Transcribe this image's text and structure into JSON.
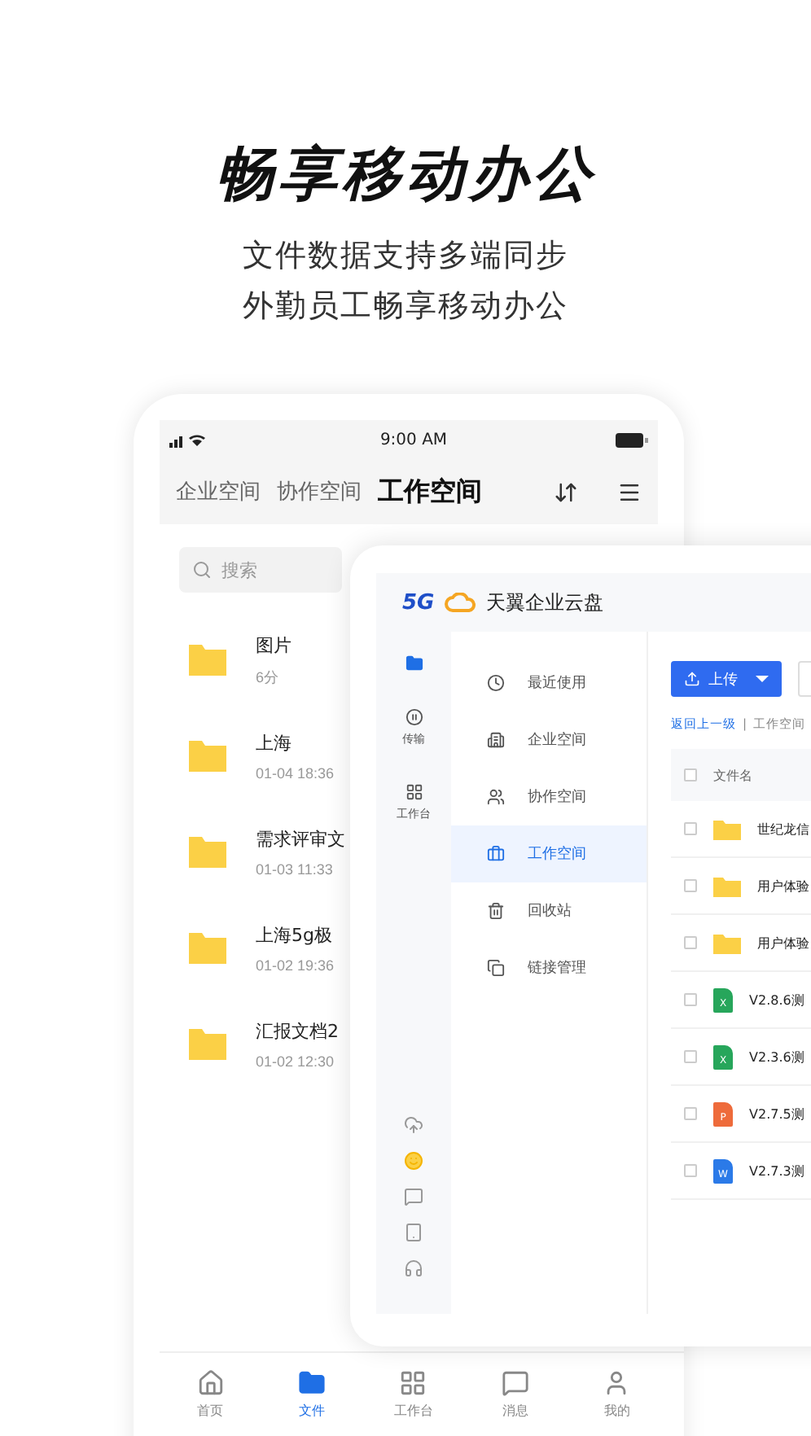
{
  "headline": "畅享移动办公",
  "subtitle_lines": [
    "文件数据支持多端同步",
    "外勤员工畅享移动办公"
  ],
  "phone": {
    "status_bar": {
      "time": "9:00 AM"
    },
    "tabs": [
      {
        "label": "企业空间",
        "selected": false
      },
      {
        "label": "协作空间",
        "selected": false
      },
      {
        "label": "工作空间",
        "selected": true
      }
    ],
    "search": {
      "placeholder": "搜索"
    },
    "files": [
      {
        "name": "图片",
        "time": "6分"
      },
      {
        "name": "上海",
        "time": "01-04 18:36"
      },
      {
        "name": "需求评审文",
        "time": "01-03 11:33"
      },
      {
        "name": "上海5g极",
        "time": "01-02 19:36"
      },
      {
        "name": "汇报文档2",
        "time": "01-02 12:30"
      }
    ],
    "bottom_nav": [
      {
        "kind": "home",
        "label": "首页",
        "selected": false
      },
      {
        "kind": "files",
        "label": "文件",
        "selected": true
      },
      {
        "kind": "apps",
        "label": "工作台",
        "selected": false
      },
      {
        "kind": "messages",
        "label": "消息",
        "selected": false
      },
      {
        "kind": "profile",
        "label": "我的",
        "selected": false
      }
    ]
  },
  "desktop": {
    "badge": "5G",
    "brand": "天翼企业云盘",
    "rail": [
      {
        "kind": "folder",
        "selected": true
      },
      {
        "kind": "transfer",
        "label": "传输",
        "selected": false
      },
      {
        "kind": "apps",
        "label": "工作台",
        "selected": false
      }
    ],
    "menu": [
      {
        "kind": "recent",
        "label": "最近使用",
        "selected": false
      },
      {
        "kind": "enterprise",
        "label": "企业空间",
        "selected": false
      },
      {
        "kind": "team",
        "label": "协作空间",
        "selected": false
      },
      {
        "kind": "workspace",
        "label": "工作空间",
        "selected": true
      },
      {
        "kind": "trash",
        "label": "回收站",
        "selected": false
      },
      {
        "kind": "link",
        "label": "链接管理",
        "selected": false
      }
    ],
    "upload_button": "上传",
    "breadcrumb": [
      "返回上一级",
      "|",
      "工作空间"
    ],
    "column": "文件名",
    "all_checked": false,
    "files": [
      {
        "kind": "folder",
        "name": "世纪龙信",
        "checked": false
      },
      {
        "kind": "folder",
        "name": "用户体验",
        "checked": false
      },
      {
        "kind": "folder",
        "name": "用户体验",
        "checked": false
      },
      {
        "kind": "sheet",
        "badge": "X",
        "name": "V2.8.6测",
        "checked": false
      },
      {
        "kind": "sheet",
        "badge": "X",
        "name": "V2.3.6测",
        "checked": false
      },
      {
        "kind": "slides",
        "badge": "P",
        "name": "V2.7.5测",
        "checked": false
      },
      {
        "kind": "doc",
        "badge": "W",
        "name": "V2.7.3测",
        "checked": false
      }
    ]
  }
}
